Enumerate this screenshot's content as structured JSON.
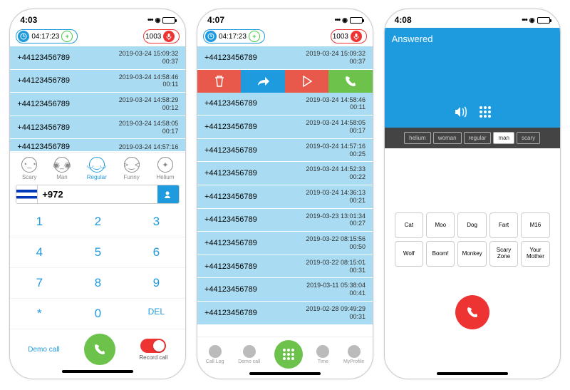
{
  "screen1": {
    "time": "4:03",
    "timer": "04:17:23",
    "credits": "1003",
    "calls": [
      {
        "num": "+44123456789",
        "ts": "2019-03-24 15:09:32",
        "dur": "00:37"
      },
      {
        "num": "+44123456789",
        "ts": "2019-03-24 14:58:46",
        "dur": "00:11"
      },
      {
        "num": "+44123456789",
        "ts": "2019-03-24 14:58:29",
        "dur": "00:12"
      },
      {
        "num": "+44123456789",
        "ts": "2019-03-24 14:58:05",
        "dur": "00:17"
      },
      {
        "num": "+44123456789",
        "ts": "2019-03-24 14:57:16",
        "dur": ""
      }
    ],
    "voices": [
      "Scary",
      "Man",
      "Regular",
      "Funny",
      "Helium"
    ],
    "voice_active": 2,
    "prefix": "+972",
    "keys": [
      "1",
      "2",
      "3",
      "4",
      "5",
      "6",
      "7",
      "8",
      "9",
      "*",
      "0",
      "DEL"
    ],
    "demo": "Demo call",
    "record": "Record call"
  },
  "screen2": {
    "time": "4:07",
    "timer": "04:17:23",
    "credits": "1003",
    "calls": [
      {
        "num": "+44123456789",
        "ts": "2019-03-24 15:09:32",
        "dur": "00:37"
      },
      {
        "num": "+44123456789",
        "ts": "2019-03-24 14:58:46",
        "dur": "00:11"
      },
      {
        "num": "+44123456789",
        "ts": "2019-03-24 14:58:05",
        "dur": "00:17"
      },
      {
        "num": "+44123456789",
        "ts": "2019-03-24 14:57:16",
        "dur": "00:25"
      },
      {
        "num": "+44123456789",
        "ts": "2019-03-24 14:52:33",
        "dur": "00:22"
      },
      {
        "num": "+44123456789",
        "ts": "2019-03-24 14:36:13",
        "dur": "00:21"
      },
      {
        "num": "+44123456789",
        "ts": "2019-03-23 13:01:34",
        "dur": "00:27"
      },
      {
        "num": "+44123456789",
        "ts": "2019-03-22 08:15:56",
        "dur": "00:50"
      },
      {
        "num": "+44123456789",
        "ts": "2019-03-22 08:15:01",
        "dur": "00:31"
      },
      {
        "num": "+44123456789",
        "ts": "2019-03-11 05:38:04",
        "dur": "00:41"
      },
      {
        "num": "+44123456789",
        "ts": "2019-02-28 09:49:29",
        "dur": "00:31"
      }
    ],
    "tabs": [
      "Call Log",
      "Demo call",
      "",
      "Time",
      "MyProfile"
    ]
  },
  "screen3": {
    "time": "4:08",
    "title": "Answered",
    "chips": [
      "helium",
      "woman",
      "regular",
      "man",
      "scary"
    ],
    "chip_active": 3,
    "sounds": [
      "Cat",
      "Moo",
      "Dog",
      "Fart",
      "M16",
      "Wolf",
      "Boom!",
      "Monkey",
      "Scary Zone",
      "Your Mother"
    ]
  }
}
